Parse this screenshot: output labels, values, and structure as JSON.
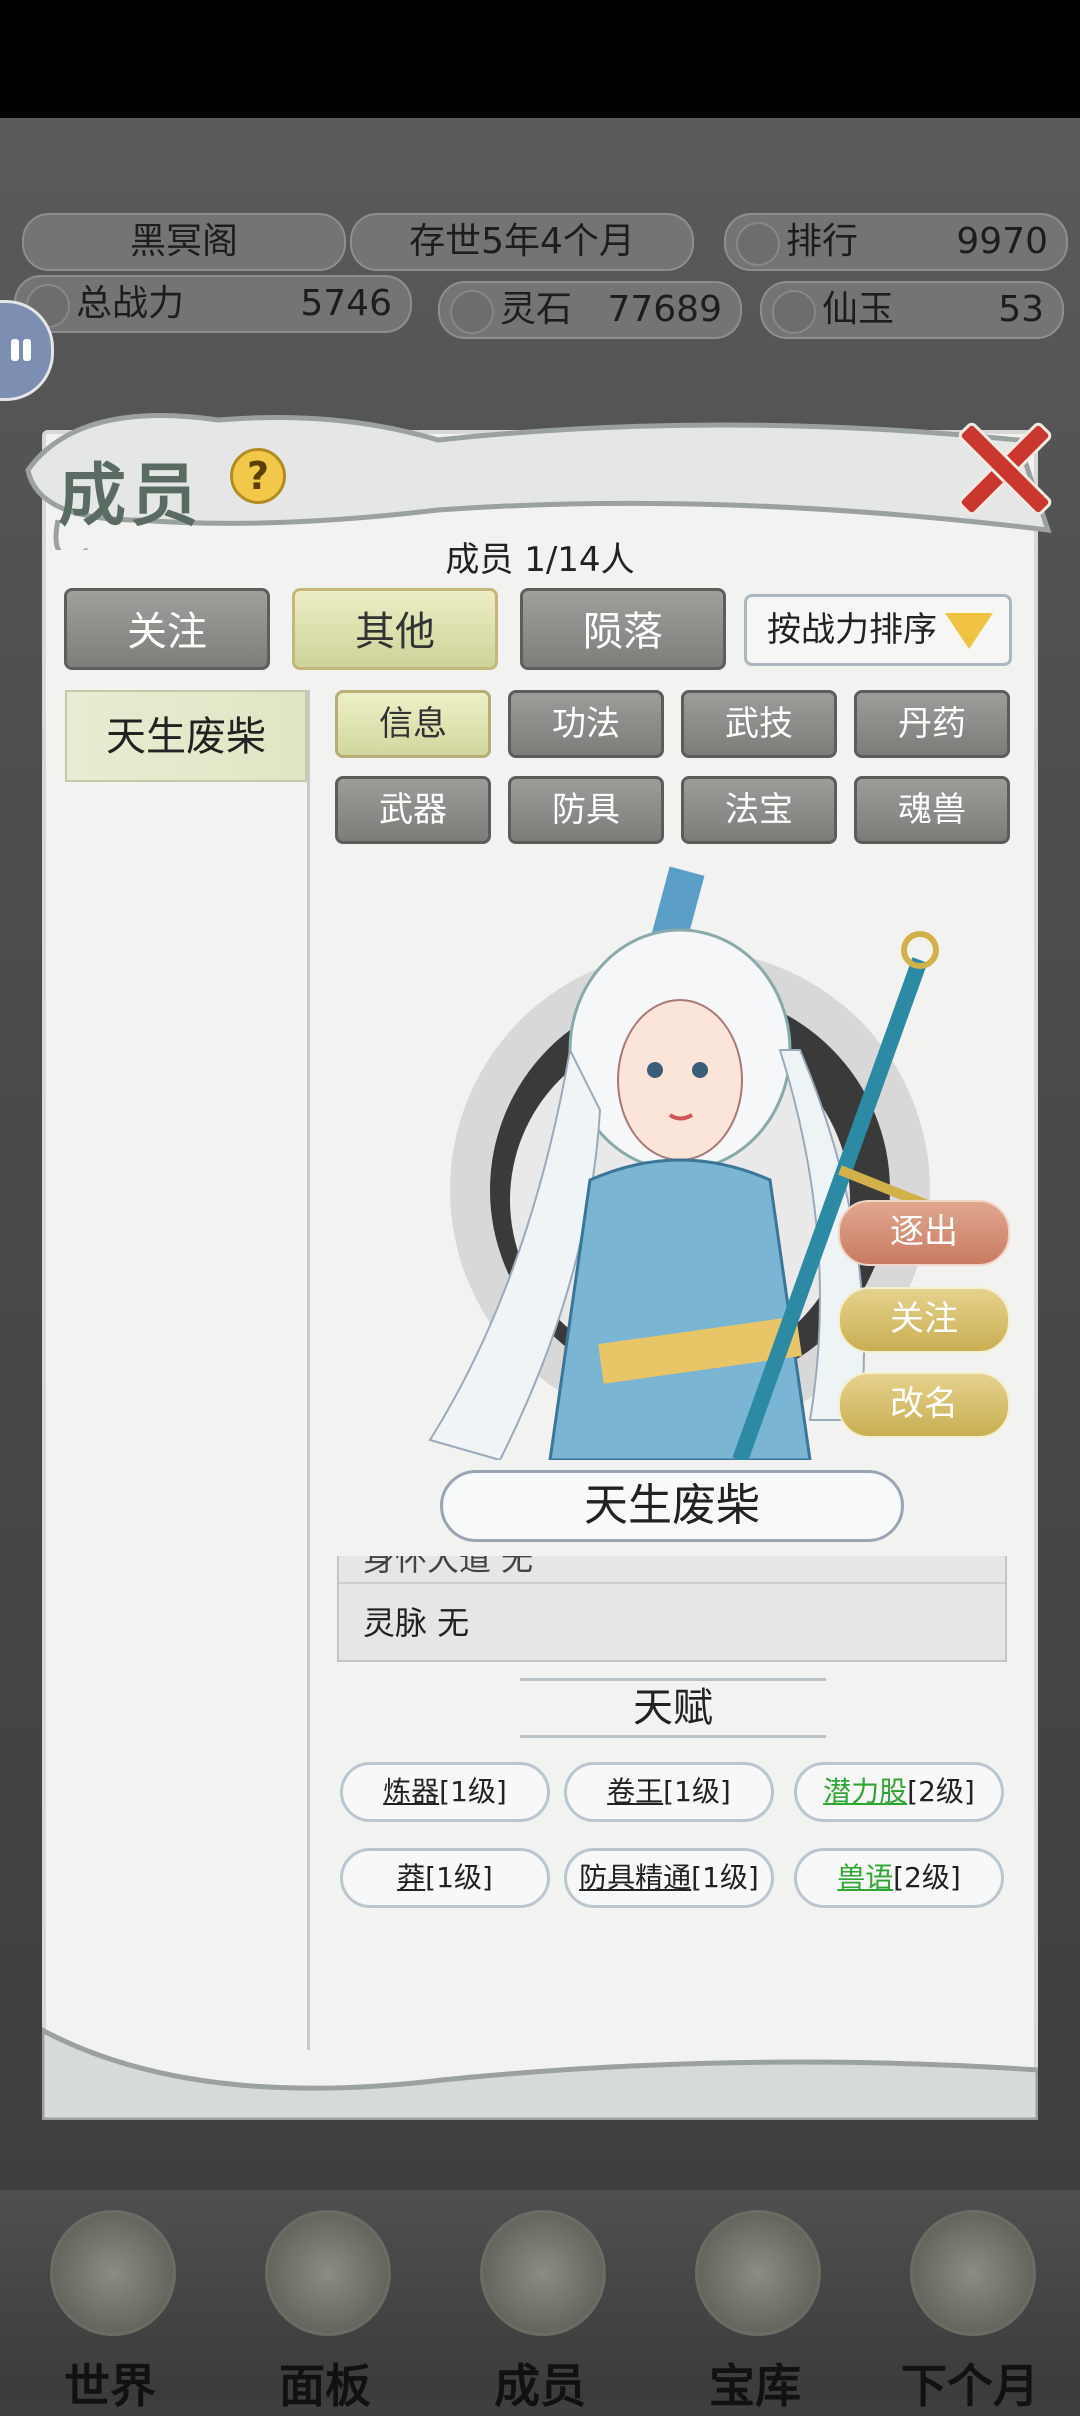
{
  "header": {
    "sect_name": "黑冥阁",
    "age": "存世5年4个月",
    "rank_label": "排行",
    "rank_value": "9970",
    "power_label": "总战力",
    "power_value": "5746",
    "spirit_stone_label": "灵石",
    "spirit_stone_value": "77689",
    "jade_label": "仙玉",
    "jade_value": "53"
  },
  "modal": {
    "title": "成员",
    "help": "?",
    "member_count": "成员  1/14人",
    "filters": [
      "关注",
      "其他",
      "陨落"
    ],
    "active_filter": "其他",
    "sort_label": "按战力排序"
  },
  "member_list": [
    "天生废柴"
  ],
  "subtabs": [
    "信息",
    "功法",
    "武技",
    "丹药",
    "武器",
    "防具",
    "法宝",
    "魂兽"
  ],
  "active_subtab": "信息",
  "actions": {
    "expel": "逐出",
    "follow": "关注",
    "rename": "改名"
  },
  "character_name": "天生废柴",
  "info": {
    "cut_row": "身怀大道 无",
    "spirit_vein": "灵脉 无"
  },
  "talent": {
    "heading": "天赋",
    "items": [
      {
        "name": "炼器",
        "level": "[1级]",
        "color": "#222222"
      },
      {
        "name": "卷王",
        "level": "[1级]",
        "color": "#222222"
      },
      {
        "name": "潜力股",
        "level": "[2级]",
        "color": "#2fa733"
      },
      {
        "name": "莽",
        "level": "[1级]",
        "color": "#222222"
      },
      {
        "name": "防具精通",
        "level": "[1级]",
        "color": "#222222"
      },
      {
        "name": "兽语",
        "level": "[2级]",
        "color": "#2fa733"
      }
    ]
  },
  "nav": [
    "世界",
    "面板",
    "成员",
    "宝库",
    "下个月"
  ]
}
